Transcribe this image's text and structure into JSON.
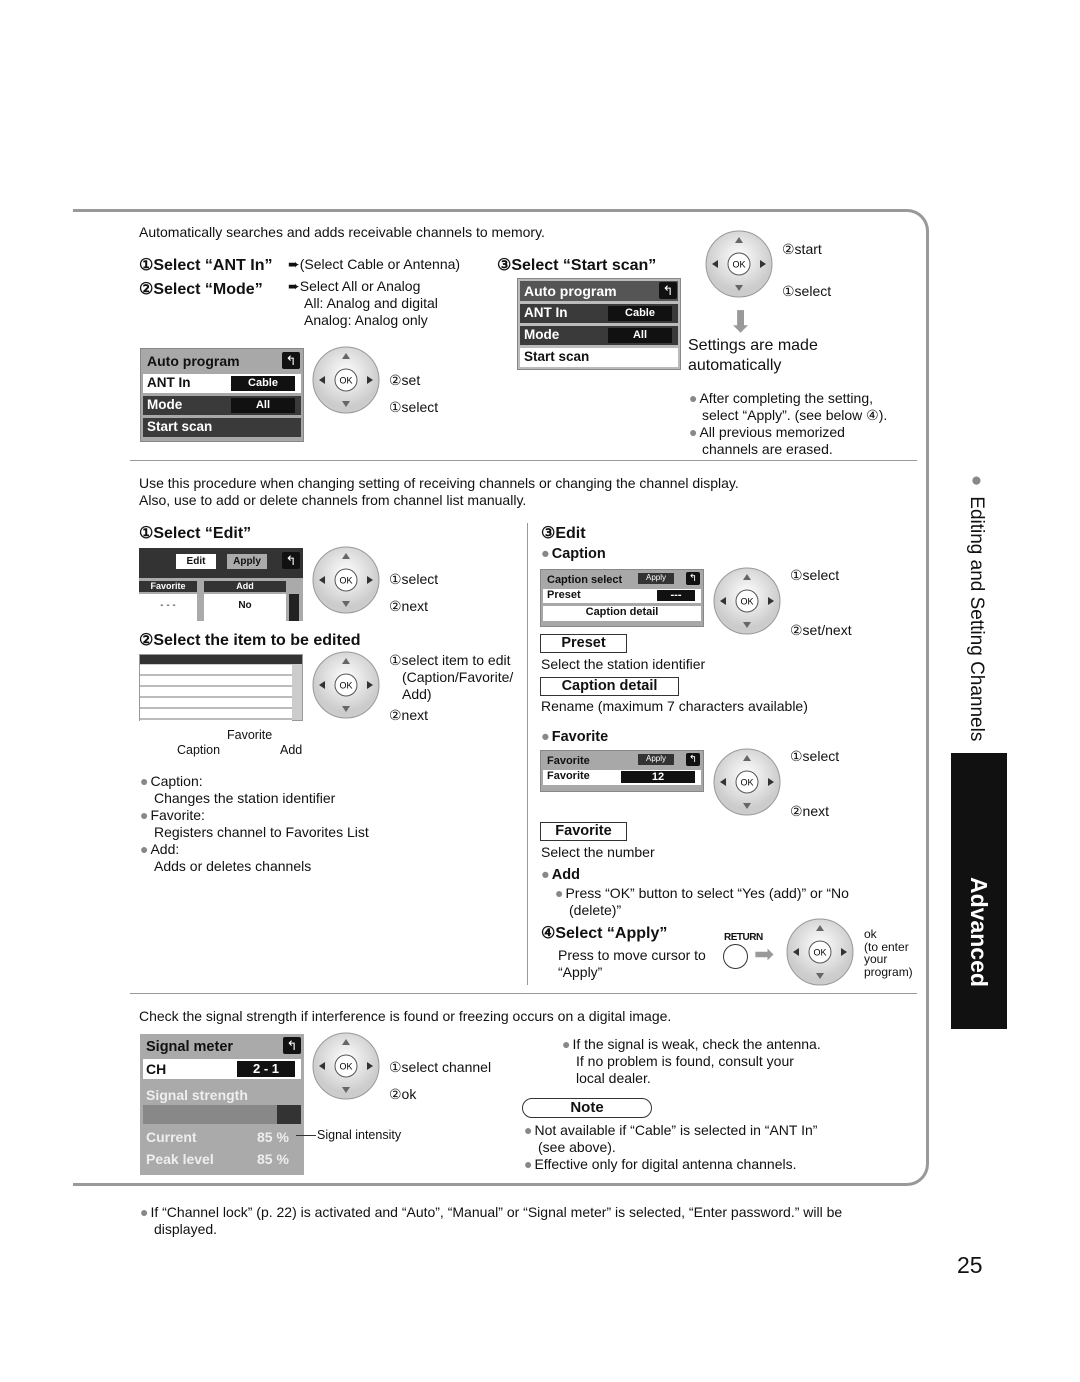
{
  "auto": {
    "intro": "Automatically searches and adds receivable channels to memory.",
    "step1": "①Select “ANT In”",
    "step1_note": "(Select Cable or Antenna)",
    "step2": "②Select “Mode”",
    "step2_notes": [
      "Select All or Analog",
      "All: Analog and digital",
      "Analog: Analog only"
    ],
    "step3": "③Select “Start scan”",
    "menu": {
      "title": "Auto program",
      "ant_in": "ANT In",
      "ant_val": "Cable",
      "mode": "Mode",
      "mode_val": "All",
      "start": "Start scan"
    },
    "dial1": {
      "set": "②set",
      "select": "①select"
    },
    "dial2": {
      "start": "②start",
      "select": "①select"
    },
    "result": [
      "Settings are made",
      "automatically"
    ],
    "notes": [
      "After completing the setting,",
      "select “Apply”. (see below ④).",
      "All previous memorized",
      "channels are erased."
    ]
  },
  "edit": {
    "intro": [
      "Use this procedure when changing setting of receiving channels or changing the channel display.",
      "Also, use to add or delete channels from channel list manually."
    ],
    "step1": "①Select “Edit”",
    "menu1": {
      "edit": "Edit",
      "apply": "Apply",
      "col_fav": "Favorite",
      "col_add": "Add",
      "fav_val": "- - -",
      "add_val": "No"
    },
    "dial1": {
      "select": "①select",
      "next": "②next"
    },
    "step2": "②Select the item to be edited",
    "dial2": {
      "select": "①select item to edit",
      "select2": "(Caption/Favorite/",
      "select3": "Add)",
      "next": "②next"
    },
    "callouts": {
      "favorite": "Favorite",
      "caption": "Caption",
      "add": "Add"
    },
    "bullets": [
      {
        "title": "Caption:",
        "desc": "Changes the station identifier"
      },
      {
        "title": "Favorite:",
        "desc": "Registers channel to Favorites List"
      },
      {
        "title": "Add:",
        "desc": "Adds or deletes channels"
      }
    ],
    "step3": "③Edit",
    "caption": {
      "head": "Caption",
      "menu_title": "Caption select",
      "apply": "Apply",
      "preset": "Preset",
      "preset_val": "---",
      "detail": "Caption detail",
      "dial_select": "①select",
      "dial_next": "②set/next",
      "preset_box": "Preset",
      "preset_desc": "Select the station identifier",
      "detail_box": "Caption detail",
      "detail_desc": "Rename (maximum 7 characters available)"
    },
    "favorite": {
      "head": "Favorite",
      "menu_title": "Favorite",
      "apply": "Apply",
      "row": "Favorite",
      "row_val": "12",
      "dial_select": "①select",
      "dial_next": "②next",
      "box": "Favorite",
      "desc": "Select the number"
    },
    "add": {
      "head": "Add",
      "desc1": "Press “OK” button to select “Yes (add)” or “No",
      "desc2": "(delete)”"
    },
    "step4": "④Select “Apply”",
    "step4_desc": [
      "Press to move cursor to",
      "“Apply”"
    ],
    "return_label": "RETURN",
    "ok_notes": [
      "ok",
      "(to enter",
      "your",
      "program)"
    ]
  },
  "signal": {
    "intro": "Check the signal strength if interference is found or freezing occurs on a digital image.",
    "menu": {
      "title": "Signal meter",
      "ch": "CH",
      "ch_val": "2 - 1",
      "strength": "Signal strength",
      "current": "Current",
      "current_val": "85 %",
      "peak": "Peak level",
      "peak_val": "85 %"
    },
    "strength_percent": 85,
    "dial": {
      "select": "①select channel",
      "ok": "②ok"
    },
    "intensity": "Signal intensity",
    "notes": [
      "If the signal is weak, check the antenna.",
      "If no problem is found, consult your",
      "local dealer."
    ],
    "note_title": "Note",
    "note_items": [
      "Not available if “Cable” is selected in “ANT In”",
      "(see above).",
      "Effective only for digital antenna channels."
    ]
  },
  "footer": {
    "note1": "If “Channel lock” (p. 22) is activated and “Auto”, “Manual” or “Signal meter” is selected, “Enter password.” will be",
    "note2": "displayed.",
    "page": "25"
  },
  "side": {
    "section": "Editing and Setting Channels",
    "tab": "Advanced"
  }
}
